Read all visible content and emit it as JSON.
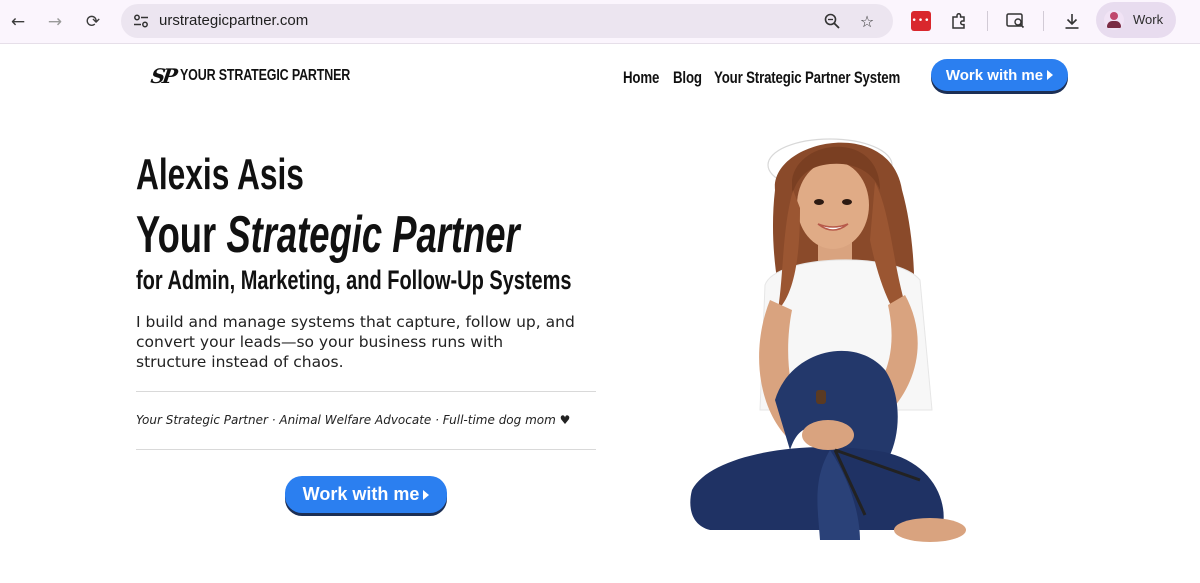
{
  "browser": {
    "url": "urstrategicpartner.com",
    "profile_label": "Work"
  },
  "site": {
    "logo_mark": "SP",
    "logo_text": "YOUR STRATEGIC PARTNER",
    "nav": [
      "Home",
      "Blog",
      "Your Strategic Partner System"
    ],
    "cta_label": "Work with me"
  },
  "hero": {
    "name": "Alexis Asis",
    "headline_prefix": "Your",
    "headline_emphasis": "Strategic Partner",
    "subheadline": "for Admin, Marketing, and Follow-Up Systems",
    "body": "I build and manage systems that capture, follow up, and convert your leads—so your business runs with structure instead of chaos.",
    "tagline": "Your Strategic Partner · Animal Welfare Advocate · Full-time dog mom ♥",
    "cta_label": "Work with me"
  },
  "colors": {
    "accent": "#2b7ff0",
    "button_shadow": "#1c2f55",
    "chrome_bg": "#fbf5fd"
  },
  "icons": [
    "back-arrow-icon",
    "forward-arrow-icon",
    "reload-icon",
    "site-settings-icon",
    "zoom-icon",
    "bookmark-star-icon",
    "extension-icon",
    "puzzle-icon",
    "tab-search-icon",
    "download-icon",
    "profile-avatar-icon",
    "play-triangle-icon"
  ]
}
